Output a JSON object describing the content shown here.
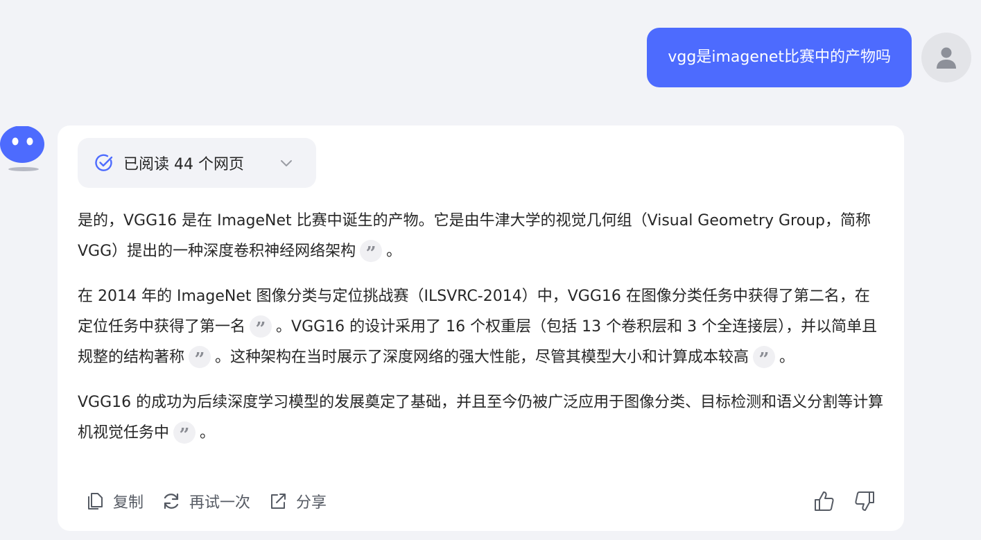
{
  "user_message": {
    "text": "vgg是imagenet比赛中的产物吗",
    "avatar_icon": "user-icon"
  },
  "assistant": {
    "avatar_icon": "bot-icon",
    "sources": {
      "label": "已阅读 44 个网页",
      "check_icon": "check-circle-icon",
      "chevron_icon": "chevron-down-icon"
    },
    "paragraphs": [
      {
        "segments": [
          "是的，VGG16 是在 ImageNet 比赛中诞生的产物。它是由牛津大学的视觉几何组（Visual Geometry Group，简称 VGG）提出的一种深度卷积神经网络架构",
          "。"
        ]
      },
      {
        "segments": [
          "在 2014 年的 ImageNet 图像分类与定位挑战赛（ILSVRC-2014）中，VGG16 在图像分类任务中获得了第二名，在定位任务中获得了第一名",
          "。VGG16 的设计采用了 16 个权重层（包括 13 个卷积层和 3 个全连接层），并以简单且规整的结构著称",
          "。这种架构在当时展示了深度网络的强大性能，尽管其模型大小和计算成本较高",
          "。"
        ]
      },
      {
        "segments": [
          "VGG16 的成功为后续深度学习模型的发展奠定了基础，并且至今仍被广泛应用于图像分类、目标检测和语义分割等计算机视觉任务中",
          "。"
        ]
      }
    ],
    "citation_glyph": "”",
    "actions": {
      "copy": "复制",
      "retry": "再试一次",
      "share": "分享"
    },
    "colors": {
      "accent": "#4d6bfe",
      "page_bg": "#f2f3f7",
      "card_bg": "#ffffff"
    }
  }
}
